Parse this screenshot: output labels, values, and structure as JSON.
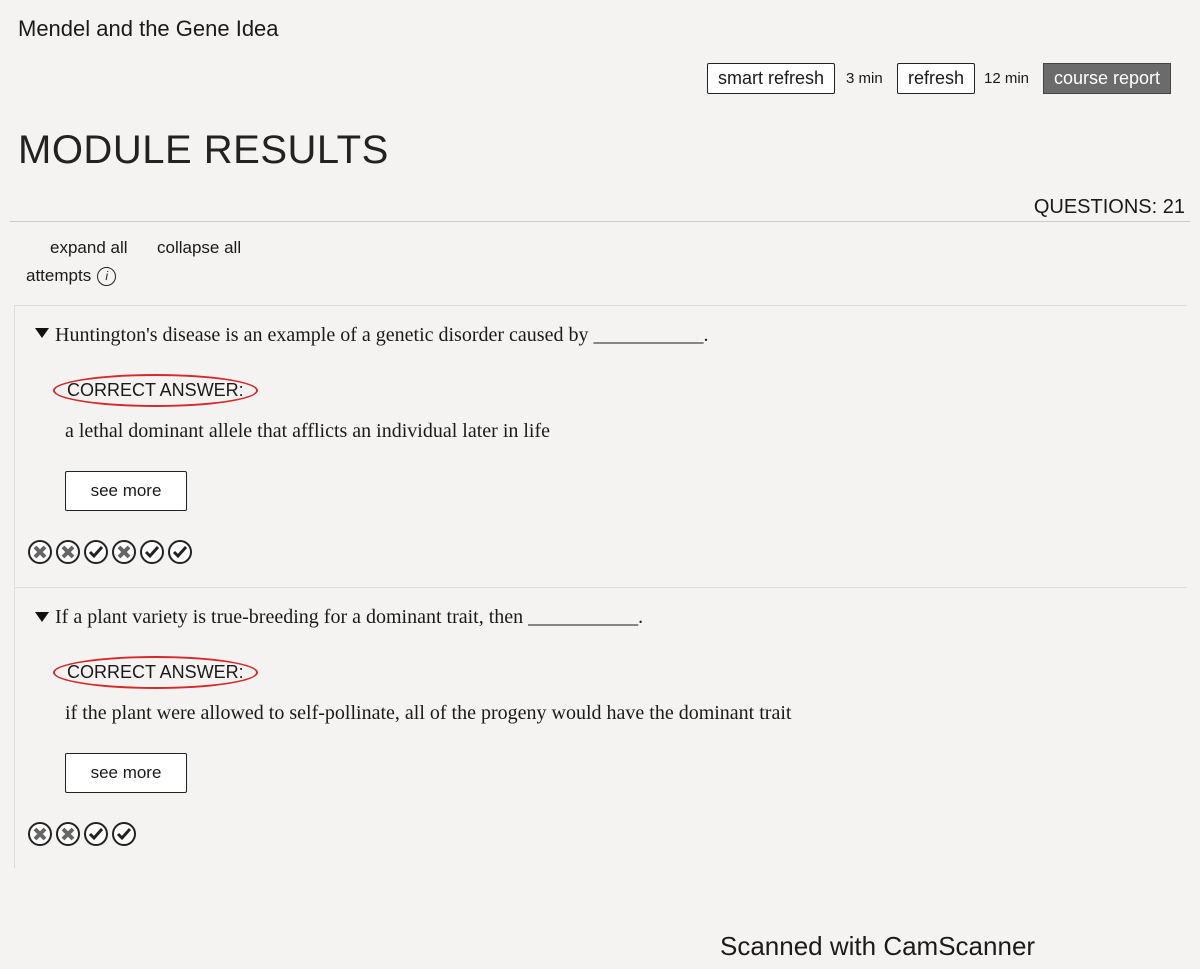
{
  "course_title": "Mendel and the Gene Idea",
  "toolbar": {
    "smart_refresh": "smart refresh",
    "smart_refresh_age": "3 min",
    "refresh": "refresh",
    "refresh_age": "12 min",
    "course_report": "course report"
  },
  "module_title": "MODULE RESULTS",
  "questions_count": "QUESTIONS: 21",
  "controls": {
    "expand_all": "expand all",
    "collapse_all": "collapse all",
    "attempts": "attempts",
    "info_icon": "i"
  },
  "questions": [
    {
      "text": "Huntington's disease is an example of a genetic disorder caused by ___________.",
      "correct_label": "CORRECT ANSWER:",
      "answer": "a lethal dominant allele that afflicts an individual later in life",
      "see_more": "see more",
      "attempts": [
        "incorrect",
        "incorrect",
        "correct",
        "incorrect",
        "correct",
        "correct"
      ]
    },
    {
      "text": "If a plant variety is true-breeding for a dominant trait, then ___________.",
      "correct_label": "CORRECT ANSWER:",
      "answer": "if the plant were allowed to self-pollinate, all of the progeny would have the dominant trait",
      "see_more": "see more",
      "attempts": [
        "incorrect",
        "incorrect",
        "correct",
        "correct"
      ]
    }
  ],
  "watermark": "Scanned with CamScanner"
}
